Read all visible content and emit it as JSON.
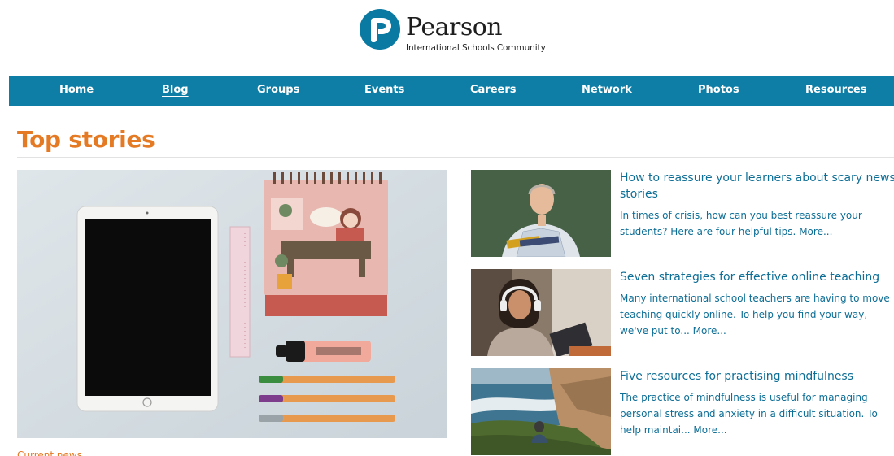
{
  "brand": {
    "name": "Pearson",
    "subtitle": "International Schools Community",
    "color": "#0b7aa2"
  },
  "nav": {
    "background": "#0e7ea6",
    "items": [
      {
        "label": "Home"
      },
      {
        "label": "Blog",
        "active": true
      },
      {
        "label": "Groups"
      },
      {
        "label": "Events"
      },
      {
        "label": "Careers"
      },
      {
        "label": "Network"
      },
      {
        "label": "Photos"
      },
      {
        "label": "Resources"
      }
    ]
  },
  "section": {
    "title": "Top stories",
    "accent": "#e57a25"
  },
  "hero": {
    "caption": "Current news"
  },
  "stories": [
    {
      "title": "How to reassure your learners about scary news stories",
      "description": "In times of crisis, how can you best reassure your students? Here are four helpful tips.",
      "more": "More..."
    },
    {
      "title": "Seven strategies for effective online teaching",
      "description": "Many international school teachers are having to move teaching quickly online. To help you find your way, we've put to...",
      "more": "More..."
    },
    {
      "title": "Five resources for practising mindfulness",
      "description": "The practice of mindfulness is useful for managing personal stress and anxiety in a difficult situation. To help maintai...",
      "more": "More..."
    }
  ],
  "link_color": "#0d6e96"
}
